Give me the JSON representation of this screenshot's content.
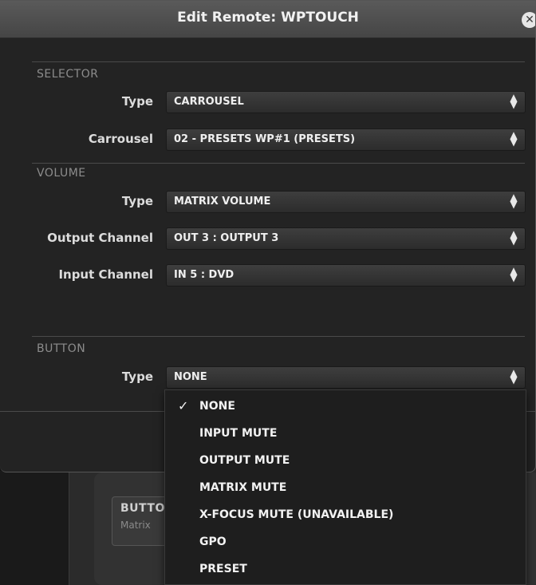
{
  "dialog": {
    "title": "Edit Remote: WPTOUCH",
    "close_glyph": "✕"
  },
  "selector": {
    "section_title": "SELECTOR",
    "type_label": "Type",
    "type_value": "CARROUSEL",
    "carrousel_label": "Carrousel",
    "carrousel_value": "02 - PRESETS WP#1 (PRESETS)"
  },
  "volume": {
    "section_title": "VOLUME",
    "type_label": "Type",
    "type_value": "MATRIX VOLUME",
    "output_label": "Output Channel",
    "output_value": "OUT 3 : OUTPUT 3",
    "input_label": "Input Channel",
    "input_value": "IN 5 : DVD"
  },
  "button": {
    "section_title": "BUTTON",
    "type_label": "Type",
    "type_value": "NONE"
  },
  "dropdown": {
    "selected_check": "✓",
    "options": [
      "NONE",
      "INPUT MUTE",
      "OUTPUT MUTE",
      "MATRIX MUTE",
      "X-FOCUS MUTE (UNAVAILABLE)",
      "GPO",
      "PRESET"
    ]
  },
  "background": {
    "box_title": "BUTTO",
    "box_subtitle": "Matrix"
  },
  "icons": {
    "select_arrows": "updown-chevron-icon",
    "close": "close-icon",
    "check": "checkmark-icon"
  }
}
